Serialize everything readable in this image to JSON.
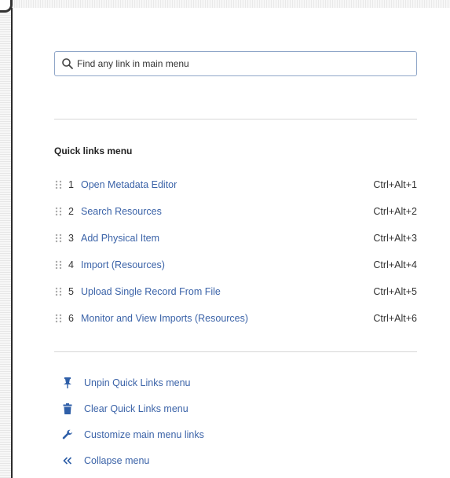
{
  "search": {
    "placeholder": "Find any link in main menu"
  },
  "quick_links": {
    "title": "Quick links menu",
    "items": [
      {
        "index": "1",
        "label": "Open Metadata Editor",
        "shortcut": "Ctrl+Alt+1"
      },
      {
        "index": "2",
        "label": "Search Resources",
        "shortcut": "Ctrl+Alt+2"
      },
      {
        "index": "3",
        "label": "Add Physical Item",
        "shortcut": "Ctrl+Alt+3"
      },
      {
        "index": "4",
        "label": "Import (Resources)",
        "shortcut": "Ctrl+Alt+4"
      },
      {
        "index": "5",
        "label": "Upload Single Record From File",
        "shortcut": "Ctrl+Alt+5"
      },
      {
        "index": "6",
        "label": "Monitor and View Imports (Resources)",
        "shortcut": "Ctrl+Alt+6"
      }
    ]
  },
  "actions": [
    {
      "icon": "pin-icon",
      "label": "Unpin Quick Links menu"
    },
    {
      "icon": "trash-icon",
      "label": "Clear Quick Links menu"
    },
    {
      "icon": "wrench-icon",
      "label": "Customize main menu links"
    },
    {
      "icon": "double-chevron-left-icon",
      "label": "Collapse menu"
    }
  ],
  "colors": {
    "link": "#3b63a8",
    "icon": "#2f5fa8",
    "search_border": "#8fa6c8",
    "divider": "#d7d7d7"
  }
}
